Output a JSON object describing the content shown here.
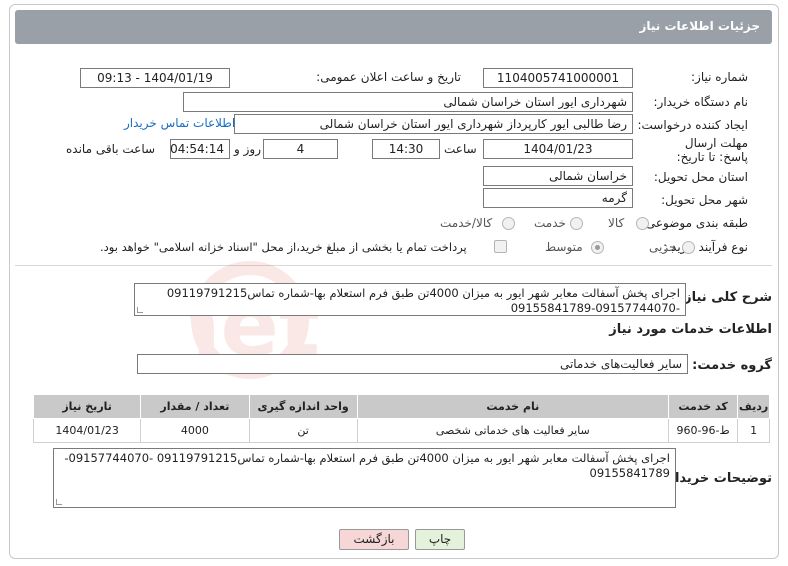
{
  "header": {
    "title": "جزئیات اطلاعات نیاز"
  },
  "fields": {
    "need_number_label": "شماره نیاز:",
    "need_number": "1104005741000001",
    "announce_label": "تاریخ و ساعت اعلان عمومی:",
    "announce_value": "1404/01/19 - 09:13",
    "buyer_org_label": "نام دستگاه خریدار:",
    "buyer_org": "شهرداری ایور استان خراسان شمالی",
    "creator_label": "ایجاد کننده درخواست:",
    "creator": "رضا  طالبی ایور کارپرداز شهرداری ایور استان خراسان شمالی",
    "contact_link": "اطلاعات تماس خریدار",
    "deadline_label": "مهلت ارسال پاسخ: تا تاریخ:",
    "deadline_date": "1404/01/23",
    "time_label": "ساعت",
    "deadline_time": "14:30",
    "days_value": "4",
    "days_label": "روز و",
    "remaining_time": "04:54:14",
    "remaining_label": "ساعت باقی مانده",
    "province_label": "استان محل تحویل:",
    "province": "خراسان شمالی",
    "city_label": "شهر محل تحویل:",
    "city": "گرمه",
    "category_label": "طبقه بندی موضوعی:",
    "category_options": [
      "کالا",
      "خدمت",
      "کالا/خدمت"
    ],
    "process_label": "نوع فرآیند خرید :",
    "process_options": [
      "جزیی",
      "متوسط"
    ],
    "payment_note": "پرداخت تمام یا بخشی از مبلغ خرید،از محل \"اسناد خزانه اسلامی\" خواهد بود."
  },
  "summary": {
    "label": "شرح کلی نیاز:",
    "text": "اجرای پخش آسفالت معابر شهر ایور به میزان 4000تن طبق فرم استعلام بها-شماره تماس09119791215 -09157744070-09155841789"
  },
  "services": {
    "section_title": "اطلاعات خدمات مورد نیاز",
    "group_label": "گروه خدمت:",
    "group_value": "سایر فعالیت‌های خدماتی",
    "columns": [
      "ردیف",
      "کد خدمت",
      "نام خدمت",
      "واحد اندازه گیری",
      "تعداد / مقدار",
      "تاریخ نیاز"
    ],
    "rows": [
      [
        "1",
        "ط-96-960",
        "سایر فعالیت های خدماتی شخصی",
        "تن",
        "4000",
        "1404/01/23"
      ]
    ]
  },
  "buyer_notes": {
    "label": "توضیحات خریدار:",
    "text": "اجرای پخش آسفالت معابر شهر ایور به میزان 4000تن طبق فرم استعلام بها-شماره تماس09119791215 -09157744070-09155841789"
  },
  "buttons": {
    "print": "چاپ",
    "back": "بازگشت"
  },
  "colors": {
    "header_bg": "#9aa0a8",
    "link": "#1a6dc2",
    "back_button_bg": "#f6d6d6",
    "print_button_bg": "#e4f2dc"
  }
}
